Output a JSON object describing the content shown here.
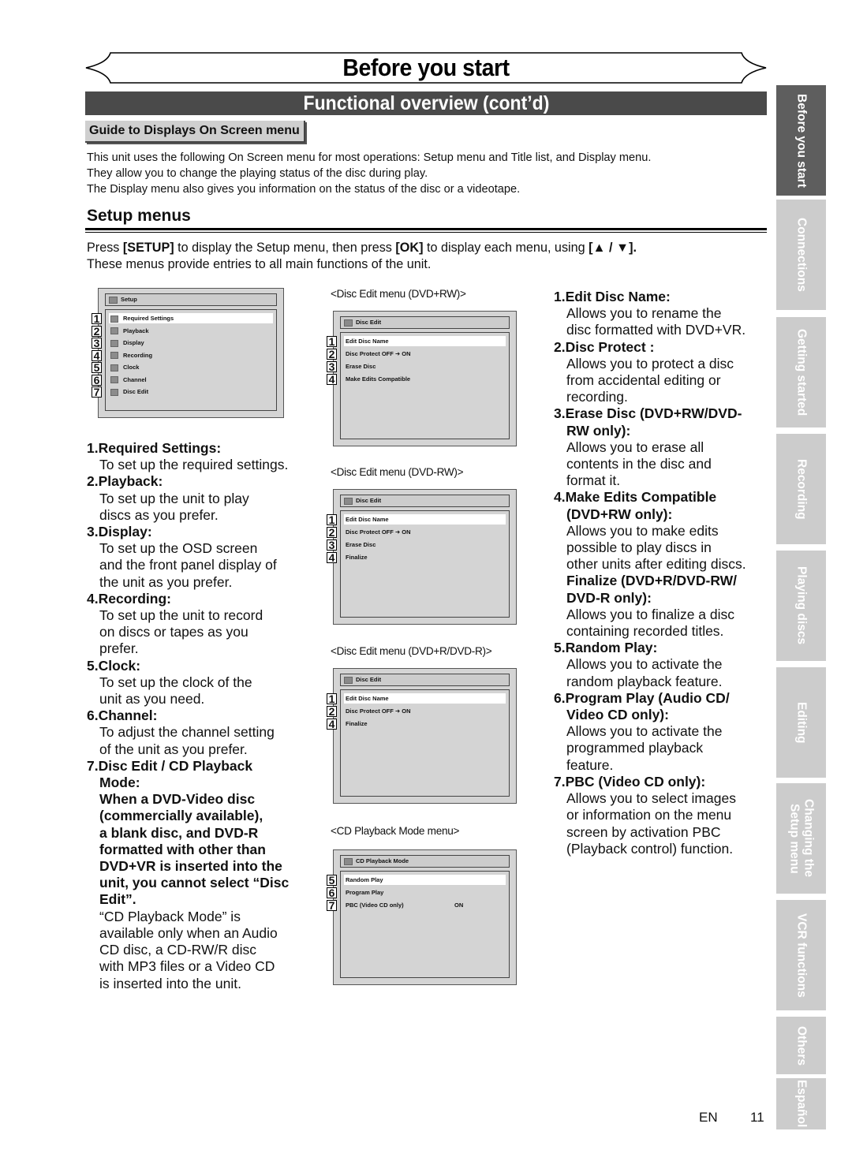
{
  "header": {
    "title": "Before you start",
    "section": "Functional overview (cont’d)",
    "guide_label": "Guide to Displays On Screen menu"
  },
  "intro": [
    "This unit uses the following On Screen menu for most operations: Setup menu and Title list, and Display menu.",
    "They allow you to change the playing status of the disc during play.",
    "The Display menu also gives you information on the status of the disc or a videotape."
  ],
  "setup_menus": {
    "heading": "Setup menus",
    "press_line1": {
      "t1": "Press ",
      "k1": "[SETUP]",
      "t2": " to display the Setup menu, then press ",
      "k2": "[OK]",
      "t3": " to display each menu, using ",
      "k3": "[▲ / ▼]."
    },
    "press_line2": "These menus provide entries to all main functions of the unit."
  },
  "screens": {
    "setup": {
      "title": "Setup",
      "items": [
        {
          "num": "1",
          "label": "Required Settings",
          "icon": "wrench-icon",
          "selected": true
        },
        {
          "num": "2",
          "label": "Playback",
          "icon": "play-icon",
          "selected": false
        },
        {
          "num": "3",
          "label": "Display",
          "icon": "display-icon",
          "selected": false
        },
        {
          "num": "4",
          "label": "Recording",
          "icon": "recording-icon",
          "selected": false
        },
        {
          "num": "5",
          "label": "Clock",
          "icon": "clock-icon",
          "selected": false
        },
        {
          "num": "6",
          "label": "Channel",
          "icon": "channel-icon",
          "selected": false
        },
        {
          "num": "7",
          "label": "Disc Edit",
          "icon": "disc-icon",
          "selected": false
        }
      ]
    },
    "disc_edit_plus_rw": {
      "caption": "<Disc Edit menu (DVD+RW)>",
      "title": "Disc Edit",
      "items": [
        {
          "num": "1",
          "label": "Edit Disc Name",
          "selected": true
        },
        {
          "num": "2",
          "label": "Disc Protect OFF ➜ ON",
          "selected": false
        },
        {
          "num": "3",
          "label": "Erase Disc",
          "selected": false
        },
        {
          "num": "4",
          "label": "Make Edits Compatible",
          "selected": false
        }
      ]
    },
    "disc_edit_minus_rw": {
      "caption": "<Disc Edit menu (DVD-RW)>",
      "title": "Disc Edit",
      "items": [
        {
          "num": "1",
          "label": "Edit Disc Name",
          "selected": true
        },
        {
          "num": "2",
          "label": "Disc Protect OFF ➜ ON",
          "selected": false
        },
        {
          "num": "3",
          "label": "Erase Disc",
          "selected": false
        },
        {
          "num": "4",
          "label": "Finalize",
          "selected": false
        }
      ]
    },
    "disc_edit_r": {
      "caption": "<Disc Edit menu (DVD+R/DVD-R)>",
      "title": "Disc Edit",
      "items": [
        {
          "num": "1",
          "label": "Edit Disc Name",
          "selected": true
        },
        {
          "num": "2",
          "label": "Disc Protect OFF ➜ ON",
          "selected": false
        },
        {
          "num": "4",
          "label": "Finalize",
          "selected": false
        }
      ]
    },
    "cd_playback": {
      "caption": "<CD Playback Mode menu>",
      "title": "CD Playback Mode",
      "items": [
        {
          "num": "5",
          "label": "Random Play",
          "value": "",
          "selected": true
        },
        {
          "num": "6",
          "label": "Program Play",
          "value": "",
          "selected": false
        },
        {
          "num": "7",
          "label": "PBC (Video CD only)",
          "value": "ON",
          "selected": false
        }
      ]
    }
  },
  "left_desc": [
    {
      "type": "h",
      "text": "1.Required Settings:"
    },
    {
      "type": "b",
      "text": "To set up the required settings."
    },
    {
      "type": "h",
      "text": "2.Playback:"
    },
    {
      "type": "b",
      "text": "To set up the unit to play"
    },
    {
      "type": "b",
      "text": "discs as you prefer."
    },
    {
      "type": "h",
      "text": "3.Display:"
    },
    {
      "type": "b",
      "text": "To set up the OSD screen"
    },
    {
      "type": "b",
      "text": "and the front panel display of"
    },
    {
      "type": "b",
      "text": "the unit as you prefer."
    },
    {
      "type": "h",
      "text": "4.Recording:"
    },
    {
      "type": "b",
      "text": "To set up the unit to record"
    },
    {
      "type": "b",
      "text": "on discs or tapes as you"
    },
    {
      "type": "b",
      "text": "prefer."
    },
    {
      "type": "h",
      "text": "5.Clock:"
    },
    {
      "type": "b",
      "text": "To set up the clock of the"
    },
    {
      "type": "b",
      "text": "unit as you need."
    },
    {
      "type": "h",
      "text": "6.Channel:"
    },
    {
      "type": "b",
      "text": "To adjust the channel setting"
    },
    {
      "type": "b",
      "text": "of the unit as you prefer."
    },
    {
      "type": "h",
      "text": "7.Disc Edit / CD Playback"
    },
    {
      "type": "bb",
      "text": "Mode:"
    },
    {
      "type": "bb",
      "text": "When a DVD-Video disc"
    },
    {
      "type": "bb",
      "text": "(commercially available),"
    },
    {
      "type": "bb",
      "text": "a blank disc, and DVD-R"
    },
    {
      "type": "bb",
      "text": "formatted with other than"
    },
    {
      "type": "bb",
      "text": "DVD+VR is inserted into the"
    },
    {
      "type": "bb",
      "text": "unit, you cannot select “Disc"
    },
    {
      "type": "bb",
      "text": "Edit”."
    },
    {
      "type": "b",
      "text": "“CD Playback Mode” is"
    },
    {
      "type": "b",
      "text": "available only when an Audio"
    },
    {
      "type": "b",
      "text": "CD disc, a CD-RW/R disc"
    },
    {
      "type": "b",
      "text": "with MP3 files or a Video CD"
    },
    {
      "type": "b",
      "text": "is inserted into the unit."
    }
  ],
  "right_desc": [
    {
      "type": "h",
      "text": "1.Edit Disc Name:"
    },
    {
      "type": "b",
      "text": "Allows you to rename the"
    },
    {
      "type": "b",
      "text": "disc formatted with DVD+VR."
    },
    {
      "type": "h",
      "text": "2.Disc Protect :"
    },
    {
      "type": "b",
      "text": "Allows you to protect a disc"
    },
    {
      "type": "b",
      "text": "from accidental editing or"
    },
    {
      "type": "b",
      "text": "recording."
    },
    {
      "type": "h",
      "text": "3.Erase Disc (DVD+RW/DVD-"
    },
    {
      "type": "bb",
      "text": "RW only):"
    },
    {
      "type": "b",
      "text": "Allows you to erase all"
    },
    {
      "type": "b",
      "text": "contents in the disc and"
    },
    {
      "type": "b",
      "text": "format it."
    },
    {
      "type": "h",
      "text": "4.Make Edits Compatible"
    },
    {
      "type": "bb",
      "text": "(DVD+RW only):"
    },
    {
      "type": "b",
      "text": "Allows you to make edits"
    },
    {
      "type": "b",
      "text": "possible to play discs in"
    },
    {
      "type": "b",
      "text": "other units after editing discs."
    },
    {
      "type": "bb",
      "text": "Finalize (DVD+R/DVD-RW/"
    },
    {
      "type": "bb",
      "text": "DVD-R only):"
    },
    {
      "type": "b",
      "text": "Allows you to finalize a disc"
    },
    {
      "type": "b",
      "text": "containing recorded titles."
    },
    {
      "type": "h",
      "text": "5.Random Play:"
    },
    {
      "type": "b",
      "text": "Allows you to activate the"
    },
    {
      "type": "b",
      "text": "random playback feature."
    },
    {
      "type": "h",
      "text": "6.Program Play (Audio CD/"
    },
    {
      "type": "bb",
      "text": "Video CD only):"
    },
    {
      "type": "b",
      "text": "Allows you to activate the"
    },
    {
      "type": "b",
      "text": "programmed playback"
    },
    {
      "type": "b",
      "text": "feature."
    },
    {
      "type": "h",
      "text": "7.PBC (Video CD only):"
    },
    {
      "type": "b",
      "text": "Allows you to select images"
    },
    {
      "type": "b",
      "text": "or information on the menu"
    },
    {
      "type": "b",
      "text": "screen by activation PBC"
    },
    {
      "type": "b",
      "text": "(Playback control) function."
    }
  ],
  "side_tabs": [
    {
      "label": "Before you start",
      "active": true
    },
    {
      "label": "Connections",
      "active": false
    },
    {
      "label": "Getting started",
      "active": false
    },
    {
      "label": "Recording",
      "active": false
    },
    {
      "label": "Playing discs",
      "active": false
    },
    {
      "label": "Editing",
      "active": false
    },
    {
      "label": "Changing the Setup menu",
      "active": false
    },
    {
      "label": "VCR functions",
      "active": false
    },
    {
      "label": "Others",
      "active": false
    },
    {
      "label": "Español",
      "active": false
    }
  ],
  "footer": {
    "lang": "EN",
    "page": "11"
  },
  "colors": {
    "section_bar": "#4a4a4a",
    "tab_active": "#5e5e5e",
    "tab_inactive": "#cccccc",
    "osd_bg": "#d4d4d4"
  }
}
